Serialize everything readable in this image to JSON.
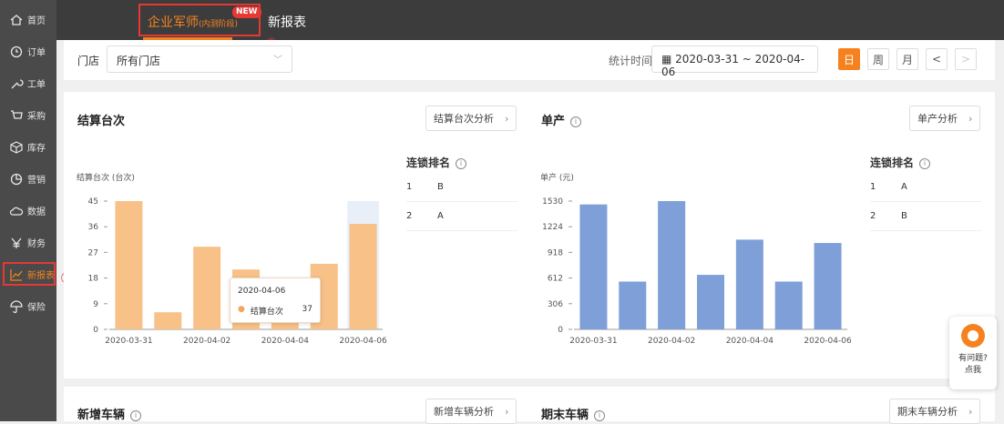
{
  "sidebar": {
    "items": [
      {
        "label": "首页",
        "icon": "home-icon"
      },
      {
        "label": "订单",
        "icon": "order-icon"
      },
      {
        "label": "工单",
        "icon": "wrench-icon"
      },
      {
        "label": "采购",
        "icon": "cart-icon"
      },
      {
        "label": "库存",
        "icon": "box-icon"
      },
      {
        "label": "营销",
        "icon": "pie-icon"
      },
      {
        "label": "数据",
        "icon": "cloud-icon"
      },
      {
        "label": "财务",
        "icon": "yen-icon"
      },
      {
        "label": "新报表",
        "icon": "chart-line-icon"
      },
      {
        "label": "保险",
        "icon": "umbrella-icon"
      }
    ],
    "active_index": 8,
    "marker1": "①"
  },
  "topbar": {
    "tab_active": "企业军师",
    "tab_active_suffix": "(内测阶段)",
    "new_badge": "NEW",
    "tab2": "新报表",
    "marker2": "②"
  },
  "filter": {
    "store_label": "门店",
    "store_value": "所有门店",
    "time_label": "统计时间",
    "date_range": "2020-03-31 ~ 2020-04-06",
    "period_buttons": [
      "日",
      "周",
      "月"
    ],
    "prev": "<",
    "next": ">",
    "accent": "#f5821f"
  },
  "panels": {
    "settle": {
      "title": "结算台次",
      "analysis": "结算台次分析",
      "ylabel": "结算台次 (台次)",
      "rank_title": "连锁排名",
      "ranks": [
        {
          "n": "1",
          "name": "B"
        },
        {
          "n": "2",
          "name": "A"
        }
      ]
    },
    "unit": {
      "title": "单产",
      "analysis": "单产分析",
      "ylabel": "单产 (元)",
      "rank_title": "连锁排名",
      "ranks": [
        {
          "n": "1",
          "name": "A"
        },
        {
          "n": "2",
          "name": "B"
        }
      ]
    },
    "newcar": {
      "title": "新增车辆",
      "analysis": "新增车辆分析"
    },
    "endcar": {
      "title": "期末车辆",
      "analysis": "期末车辆分析"
    }
  },
  "tooltip": {
    "date": "2020-04-06",
    "series": "结算台次",
    "value": "37"
  },
  "help": {
    "line1": "有问题?",
    "line2": "点我"
  },
  "chart_data": [
    {
      "type": "bar",
      "title": "结算台次",
      "ylabel": "结算台次 (台次)",
      "color": "#f7c188",
      "x": [
        "2020-03-31",
        "2020-04-01",
        "2020-04-02",
        "2020-04-03",
        "2020-04-04",
        "2020-04-05",
        "2020-04-06"
      ],
      "values": [
        45,
        6,
        29,
        21,
        12,
        23,
        37
      ],
      "yticks": [
        0,
        9,
        18,
        27,
        36,
        45
      ],
      "ylim": [
        0,
        45
      ],
      "xtick_labels": [
        "2020-03-31",
        "2020-04-02",
        "2020-04-04",
        "2020-04-06"
      ],
      "highlight": "2020-04-06"
    },
    {
      "type": "bar",
      "title": "单产",
      "ylabel": "单产 (元)",
      "color": "#7f9fd8",
      "x": [
        "2020-03-31",
        "2020-04-01",
        "2020-04-02",
        "2020-04-03",
        "2020-04-04",
        "2020-04-05",
        "2020-04-06"
      ],
      "values": [
        1490,
        570,
        1530,
        650,
        1070,
        570,
        1030
      ],
      "yticks": [
        0,
        306,
        612,
        918,
        1224,
        1530
      ],
      "ylim": [
        0,
        1530
      ],
      "xtick_labels": [
        "2020-03-31",
        "2020-04-02",
        "2020-04-04",
        "2020-04-06"
      ]
    }
  ]
}
